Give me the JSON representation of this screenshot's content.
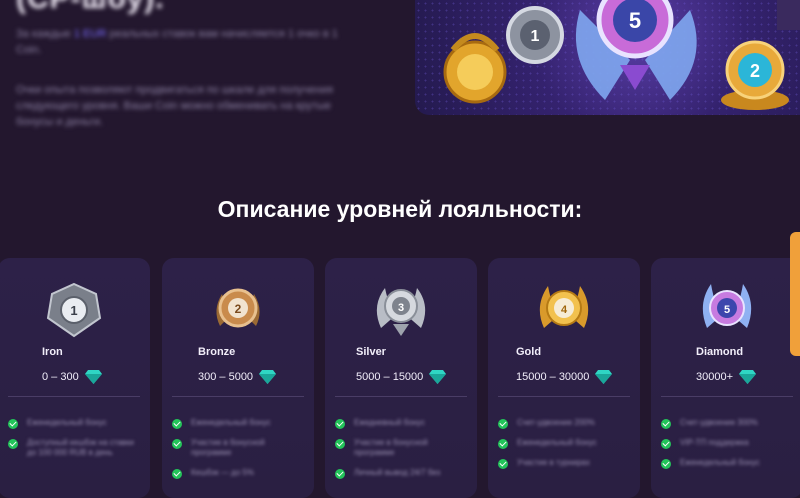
{
  "hero": {
    "title": "(CP-шоу).",
    "para1_before": "За каждые",
    "para1_highlight": "1 EUR",
    "para1_after": "реальных ставок вам начисляется 1 очко в 1 Coin.",
    "para2": "Очки опыта позволяют продвигаться по шкале для получения следующего уровня. Ваши Coin можно обменивать на крутые бонусы и деньги."
  },
  "section_title": "Описание уровней лояльности:",
  "accent_colors": {
    "check": "#23c45a",
    "gem": "#2fd6c4",
    "side_tab": "#f0a03a",
    "highlight": "#7b6cff"
  },
  "levels": [
    {
      "name": "Iron",
      "range": "0 – 300",
      "badge_number": "1",
      "icon": "iron-medal-icon",
      "perks": [
        "Еженедельный бонус",
        "Доступный кешбэк на ставки до 100 000 RUB в день"
      ]
    },
    {
      "name": "Bronze",
      "range": "300 – 5000",
      "badge_number": "2",
      "icon": "bronze-medal-icon",
      "perks": [
        "Еженедельный бонус",
        "Участие в бонусной программе",
        "Кешбэк — до 5%"
      ]
    },
    {
      "name": "Silver",
      "range": "5000 – 15000",
      "badge_number": "3",
      "icon": "silver-medal-icon",
      "perks": [
        "Ежедневный бонус",
        "Участие в бонусной программе",
        "Личный вывод 24/7 без"
      ]
    },
    {
      "name": "Gold",
      "range": "15000 – 30000",
      "badge_number": "4",
      "icon": "gold-medal-icon",
      "perks": [
        "Счет-удвоение 200%",
        "Еженедельный бонус",
        "Участие в турнирах"
      ]
    },
    {
      "name": "Diamond",
      "range": "30000+",
      "badge_number": "5",
      "icon": "diamond-medal-icon",
      "perks": [
        "Счет-удвоение 300%",
        "VIP-ТП поддержка",
        "Еженедельный бонус"
      ]
    }
  ]
}
